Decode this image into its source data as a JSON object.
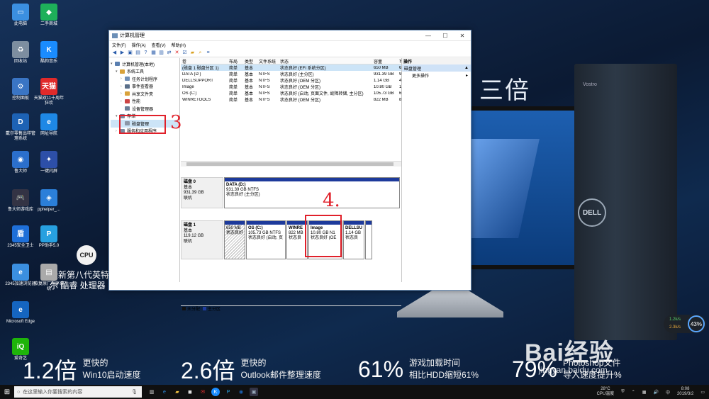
{
  "desktop": {
    "heading": "三倍",
    "monitor_brand": "Vostro",
    "tower_brand": "DELL",
    "icons": [
      {
        "label": "此电脑",
        "glyph": "▭",
        "color": "#3b8fe0"
      },
      {
        "label": "二手商城",
        "glyph": "◆",
        "color": "#1eb05a"
      },
      {
        "label": "回收站",
        "glyph": "♻",
        "color": "#7d8ea0"
      },
      {
        "label": "酷狗音乐",
        "glyph": "K",
        "color": "#1a8cff"
      },
      {
        "label": "控制面板",
        "glyph": "⚙",
        "color": "#3a75c4"
      },
      {
        "label": "天猫双11十周年狂欢",
        "glyph": "天猫",
        "color": "#e02a2a"
      },
      {
        "label": "戴尔零售出样管理系统",
        "glyph": "D",
        "color": "#1d62b4"
      },
      {
        "label": "网址导航",
        "glyph": "e",
        "color": "#1e88e5"
      },
      {
        "label": "鲁大师",
        "glyph": "◉",
        "color": "#2b6fcc"
      },
      {
        "label": "一键闪屏",
        "glyph": "✦",
        "color": "#2d4fa8"
      },
      {
        "label": "鲁大师游戏库",
        "glyph": "🎮",
        "color": "#334"
      },
      {
        "label": "pphelper_...",
        "glyph": "◈",
        "color": "#2b7fd9"
      },
      {
        "label": "2345安全卫士",
        "glyph": "盾",
        "color": "#1e6fd8"
      },
      {
        "label": "PP助手5.0",
        "glyph": "P",
        "color": "#27a0e0"
      },
      {
        "label": "2345加速浏览器",
        "glyph": "e",
        "color": "#3b8fe0"
      },
      {
        "label": "恢复原厂程序系统",
        "glyph": "▤",
        "color": "#aaa"
      },
      {
        "label": "Microsoft Edge",
        "glyph": "e",
        "color": "#1565c0"
      },
      {
        "label": "爱奇艺",
        "glyph": "iQ",
        "color": "#1eb40a"
      }
    ],
    "cpu_badge": "CPU",
    "cpu_text": "全新第八代英特尔 酷睿 处理器",
    "banners": [
      {
        "big": "1.2倍",
        "sub1": "更快的",
        "sub2": "Win10启动速度"
      },
      {
        "big": "2.6倍",
        "sub1": "更快的",
        "sub2": "Outlook邮件整理速度"
      },
      {
        "big": "61%",
        "sub1": "游戏加载时间",
        "sub2": "相比HDD缩短61%"
      },
      {
        "big": "79%",
        "sub1": "Photoshop文件",
        "sub2": "导入速度提升%"
      }
    ],
    "widget": {
      "up": "1.2k/s",
      "down": "2.3k/s",
      "percent": "43%"
    },
    "watermark": "Bai经验",
    "watermark_url": "jingyan.baidu.com"
  },
  "window": {
    "title": "计算机管理",
    "menu": [
      "文件(F)",
      "操作(A)",
      "查看(V)",
      "帮助(H)"
    ],
    "tree": [
      {
        "label": "计算机管理(本地)",
        "indent": 0,
        "arrow": "▾",
        "color": "#5a7fb0"
      },
      {
        "label": "系统工具",
        "indent": 1,
        "arrow": "▾",
        "color": "#d9a23b"
      },
      {
        "label": "任务计划程序",
        "indent": 2,
        "arrow": "›",
        "color": "#6f8fb8"
      },
      {
        "label": "事件查看器",
        "indent": 2,
        "arrow": "›",
        "color": "#5a6f8a"
      },
      {
        "label": "共享文件夹",
        "indent": 2,
        "arrow": "›",
        "color": "#d9a23b"
      },
      {
        "label": "性能",
        "indent": 2,
        "arrow": "›",
        "color": "#c44"
      },
      {
        "label": "设备管理器",
        "indent": 2,
        "arrow": "",
        "color": "#6a7d96"
      },
      {
        "label": "存储",
        "indent": 1,
        "arrow": "▾",
        "color": "#7a8aa0"
      },
      {
        "label": "磁盘管理",
        "indent": 2,
        "arrow": "",
        "color": "#8b96a6",
        "selected": true
      },
      {
        "label": "服务和应用程序",
        "indent": 1,
        "arrow": "›",
        "color": "#7a8aa0"
      }
    ],
    "columns": [
      "卷",
      "布局",
      "类型",
      "文件系统",
      "状态",
      "容量",
      "可"
    ],
    "volumes": [
      {
        "vol": "(磁盘 1 磁盘分区 1)",
        "layout": "简单",
        "type": "基本",
        "fs": "",
        "status": "状态良好 (EFI 系统分区)",
        "cap": "650 MB",
        "free": "6",
        "selected": true
      },
      {
        "vol": "DATA (D:)",
        "layout": "简单",
        "type": "基本",
        "fs": "NTFS",
        "status": "状态良好 (主分区)",
        "cap": "931.39 GB",
        "free": "9"
      },
      {
        "vol": "DELLSUPPORT",
        "layout": "简单",
        "type": "基本",
        "fs": "NTFS",
        "status": "状态良好 (OEM 分区)",
        "cap": "1.14 GB",
        "free": "4"
      },
      {
        "vol": "Image",
        "layout": "简单",
        "type": "基本",
        "fs": "NTFS",
        "status": "状态良好 (OEM 分区)",
        "cap": "10.80 GB",
        "free": "1"
      },
      {
        "vol": "OS (C:)",
        "layout": "简单",
        "type": "基本",
        "fs": "NTFS",
        "status": "状态良好 (启动, 页面文件, 故障转储, 主分区)",
        "cap": "105.73 GB",
        "free": "6"
      },
      {
        "vol": "WINRETOOLS",
        "layout": "简单",
        "type": "基本",
        "fs": "NTFS",
        "status": "状态良好 (OEM 分区)",
        "cap": "822 MB",
        "free": "8"
      }
    ],
    "disk0": {
      "name": "磁盘 0",
      "type": "基本",
      "size": "931.39 GB",
      "state": "联机",
      "part": {
        "name": "DATA (D:)",
        "size": "931.39 GB NTFS",
        "status": "状态良好 (主分区)"
      }
    },
    "disk1": {
      "name": "磁盘 1",
      "type": "基本",
      "size": "119.12 GB",
      "state": "联机",
      "parts": [
        {
          "name": "",
          "size": "650 MB",
          "status": "状态良好"
        },
        {
          "name": "OS (C:)",
          "size": "105.73 GB NTFS",
          "status": "状态良好 (启动, 页"
        },
        {
          "name": "WINRE",
          "size": "822 MB",
          "status": "状态良"
        },
        {
          "name": "Image",
          "size": "10.80 GB N1",
          "status": "状态良好 (OE"
        },
        {
          "name": "DELLSU",
          "size": "1.14 GB",
          "status": "状态良"
        },
        {
          "name": "",
          "size": "",
          "status": ""
        }
      ]
    },
    "legend": [
      {
        "label": "未分配",
        "color": "#111"
      },
      {
        "label": "主分区",
        "color": "#1d3a9b"
      }
    ],
    "actions": {
      "header": "操作",
      "section": "磁盘管理",
      "more": "更多操作"
    }
  },
  "annotations": {
    "three": "3",
    "four": "4."
  },
  "taskbar": {
    "search_placeholder": "在这里输入你要搜索的内容",
    "weather": "28°C",
    "weather_label": "CPU温度",
    "time": "8:08",
    "date": "2019/3/2",
    "lang": "中"
  }
}
